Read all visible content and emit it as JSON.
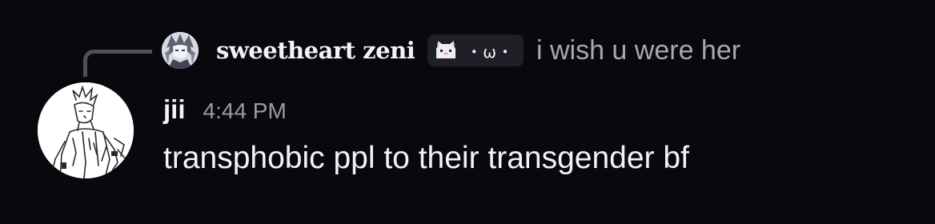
{
  "reply": {
    "author": "sweetheart zeni",
    "tag_icon": "cat-face-icon",
    "tag_text": "・ω・",
    "content": "i wish u were her"
  },
  "message": {
    "username": "jii",
    "timestamp": "4:44 PM",
    "content": "transphobic ppl to their transgender bf"
  },
  "colors": {
    "background": "#08080d",
    "text": "#f2f3f5",
    "muted": "#a7a9b1",
    "reply_line": "#4e5058",
    "tag_background": "#1f2027"
  }
}
